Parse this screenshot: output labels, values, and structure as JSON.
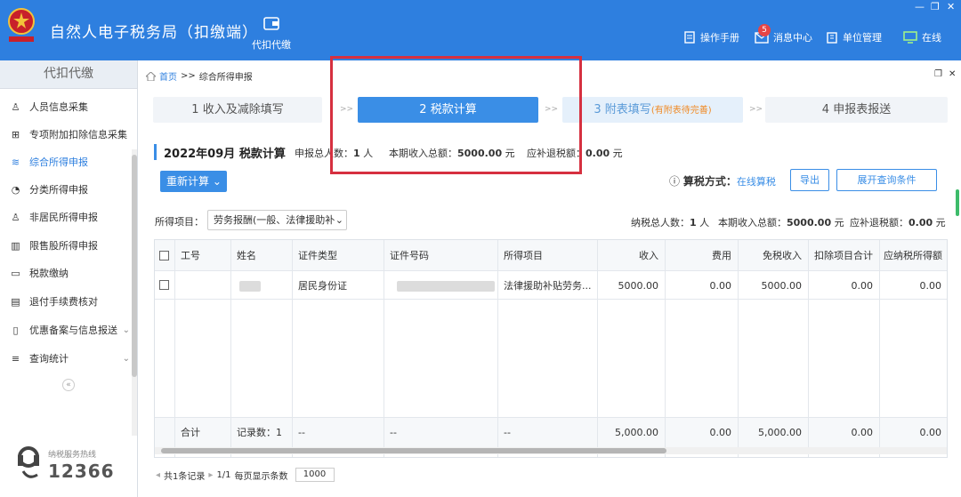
{
  "app": {
    "title": "自然人电子税务局（扣缴端）",
    "emblem_text": "中国税务",
    "top_tab": "代扣代缴",
    "top_links": {
      "manual": "操作手册",
      "messages": "消息中心",
      "message_count": "5",
      "org": "单位管理",
      "online": "在线"
    }
  },
  "sidebar": {
    "header": "代扣代缴",
    "items": [
      {
        "label": "人员信息采集",
        "icon": "person-icon"
      },
      {
        "label": "专项附加扣除信息采集",
        "icon": "grid-icon"
      },
      {
        "label": "综合所得申报",
        "icon": "layers-icon",
        "active": true
      },
      {
        "label": "分类所得申报",
        "icon": "pie-icon"
      },
      {
        "label": "非居民所得申报",
        "icon": "person-list-icon"
      },
      {
        "label": "限售股所得申报",
        "icon": "bar-chart-icon"
      },
      {
        "label": "税款缴纳",
        "icon": "folder-icon"
      },
      {
        "label": "退付手续费核对",
        "icon": "document-icon"
      },
      {
        "label": "优惠备案与信息报送",
        "icon": "file-icon",
        "expandable": true
      },
      {
        "label": "查询统计",
        "icon": "query-icon",
        "expandable": true
      }
    ],
    "collapse": "«",
    "hotline_label": "纳税服务热线",
    "hotline_number": "12366"
  },
  "breadcrumb": {
    "home": "首页",
    "sep": ">>",
    "current": "综合所得申报"
  },
  "steps": [
    {
      "num": "1",
      "label": "收入及减除填写"
    },
    {
      "num": "2",
      "label": "税款计算"
    },
    {
      "num": "3",
      "label": "附表填写",
      "note": "(有附表待完善)"
    },
    {
      "num": "4",
      "label": "申报表报送"
    }
  ],
  "step_sep": ">>",
  "info": {
    "period": "2022年09月",
    "section": "税款计算",
    "total_people_label": "申报总人数：",
    "total_people": "1",
    "people_unit": "人",
    "income_label": "本期收入总额：",
    "income": "5000.00",
    "currency_unit": "元",
    "refund_label": "应补退税额：",
    "refund": "0.00"
  },
  "actions": {
    "recalc": "重新计算",
    "tax_mode_label": "算税方式：",
    "tax_mode_value": "在线算税",
    "export": "导出",
    "expand_query": "展开查询条件"
  },
  "filter": {
    "label": "所得项目：",
    "value": "劳务报酬(一般、法律援助补"
  },
  "summary": {
    "people_label": "纳税总人数：",
    "people": "1",
    "people_unit": "人",
    "income_label": "本期收入总额：",
    "income": "5000.00",
    "currency_unit": "元",
    "refund_label": "应补退税额：",
    "refund": "0.00",
    "refund_unit": "元"
  },
  "table": {
    "headers": [
      "工号",
      "姓名",
      "证件类型",
      "证件号码",
      "所得项目",
      "收入",
      "费用",
      "免税收入",
      "扣除项目合计",
      "应纳税所得额"
    ],
    "rows": [
      {
        "id": "",
        "name": "",
        "id_type": "居民身份证",
        "id_no": "",
        "item": "法律援助补贴劳务...",
        "income": "5000.00",
        "fee": "0.00",
        "tax_free": "5000.00",
        "deduction": "0.00",
        "taxable": "0.00"
      }
    ],
    "footer": {
      "label": "合计",
      "count": "记录数：1",
      "dash": "--",
      "income": "5,000.00",
      "fee": "0.00",
      "tax_free": "5,000.00",
      "deduction": "0.00",
      "taxable": "0.00"
    }
  },
  "pager": {
    "total": "共1条记录",
    "page": "1/1",
    "per_page_label": "每页显示条数",
    "per_page": "1000"
  },
  "colors": {
    "brand": "#2e7fdf",
    "accent": "#3a8ee6",
    "highlight": "#d63040"
  }
}
